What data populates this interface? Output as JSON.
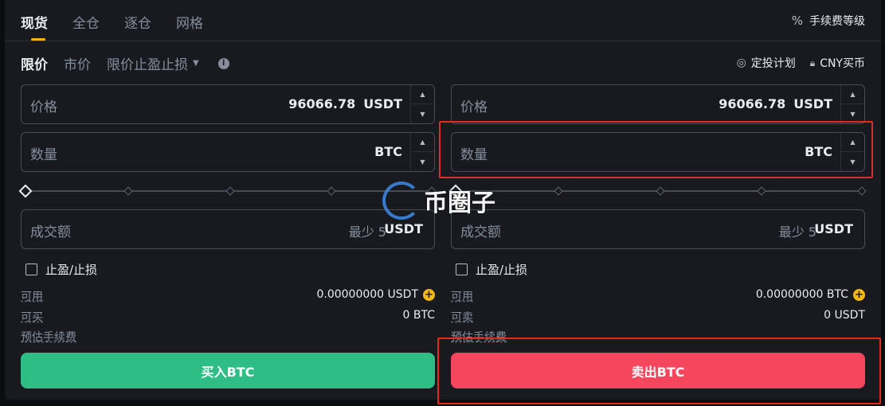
{
  "top_tabs": [
    "现货",
    "全仓",
    "逐仓",
    "网格"
  ],
  "fee_link": "手续费等级",
  "order_types": [
    "限价",
    "市价",
    "限价止盈止损"
  ],
  "right_links": {
    "auto_invest": "定投计划",
    "buy_cny": "CNY买币"
  },
  "buy": {
    "price_label": "价格",
    "price_value": "96066.78",
    "price_unit": "USDT",
    "amount_label": "数量",
    "amount_unit": "BTC",
    "total_label": "成交额",
    "total_hint": "最少 5",
    "total_unit": "USDT",
    "tpsl_label": "止盈/止损",
    "avail_label": "可用",
    "avail_value": "0.00000000 USDT",
    "max_label": "可买",
    "max_value": "0 BTC",
    "fee_label": "预估手续费",
    "button": "买入BTC"
  },
  "sell": {
    "price_label": "价格",
    "price_value": "96066.78",
    "price_unit": "USDT",
    "amount_label": "数量",
    "amount_unit": "BTC",
    "total_label": "成交额",
    "total_hint": "最少 5",
    "total_unit": "USDT",
    "tpsl_label": "止盈/止损",
    "avail_label": "可用",
    "avail_value": "0.00000000 BTC",
    "max_label": "可卖",
    "max_value": "0 USDT",
    "fee_label": "预估手续费",
    "button": "卖出BTC"
  },
  "slider_value_percent": 0,
  "watermark": "币圈子",
  "colors": {
    "buy": "#2ebd85",
    "sell": "#f6465d",
    "accent": "#f0b90b",
    "highlight": "#e02b20"
  }
}
